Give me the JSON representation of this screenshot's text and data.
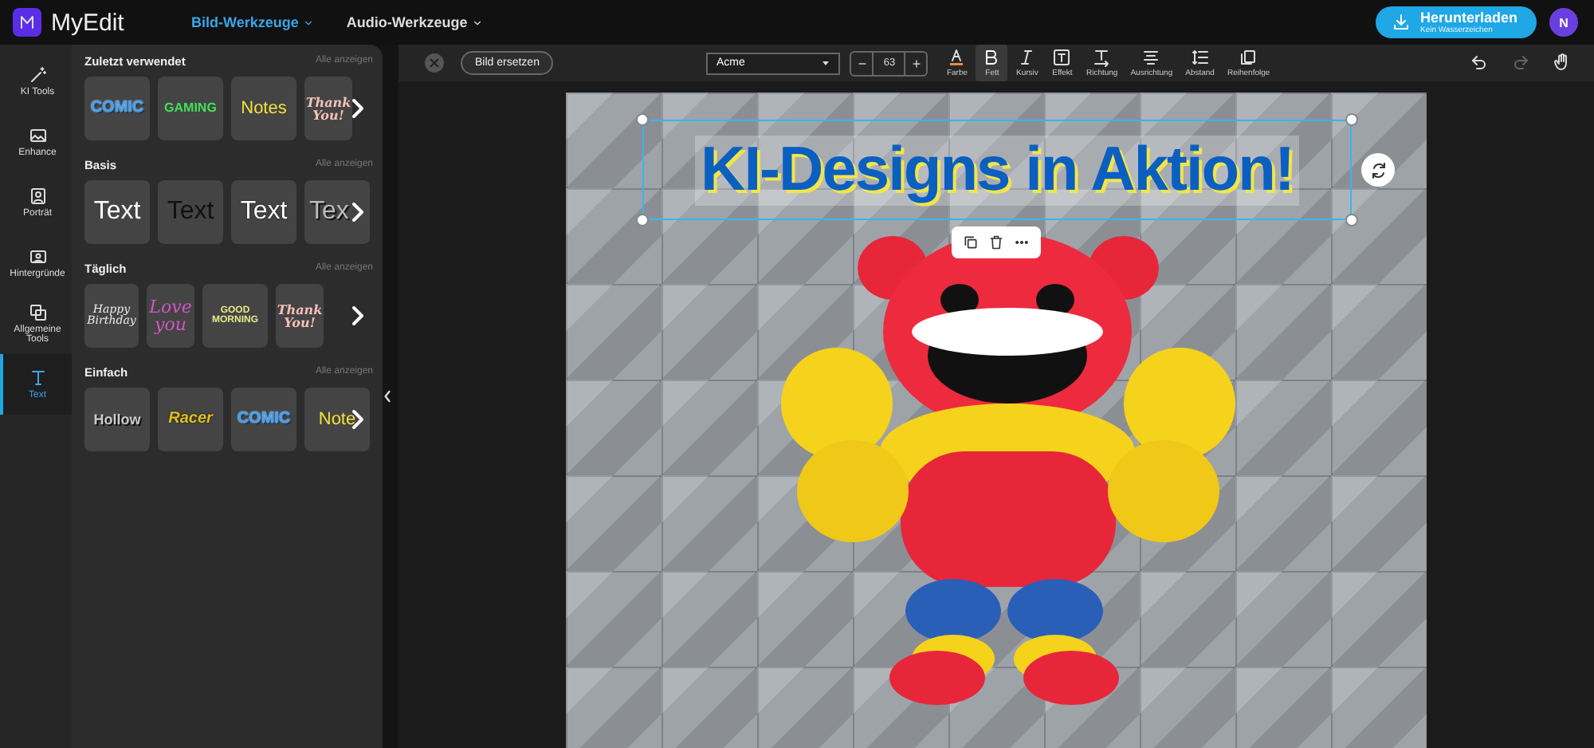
{
  "app": {
    "name": "MyEdit"
  },
  "top_menu": [
    {
      "label": "Bild-Werkzeuge",
      "selected": true
    },
    {
      "label": "Audio-Werkzeuge",
      "selected": false
    }
  ],
  "download": {
    "label": "Herunterladen",
    "sublabel": "Kein Wasserzeichen"
  },
  "avatar": {
    "initial": "N"
  },
  "nav": [
    {
      "label": "KI Tools",
      "kind": "wand",
      "selected": false
    },
    {
      "label": "Enhance",
      "kind": "enhance",
      "selected": false
    },
    {
      "label": "Porträt",
      "kind": "portrait",
      "selected": false
    },
    {
      "label": "Hintergründe",
      "kind": "background",
      "selected": false
    },
    {
      "label": "Allgemeine Tools",
      "kind": "tools",
      "selected": false
    },
    {
      "label": "Text",
      "kind": "text",
      "selected": true
    }
  ],
  "sections": [
    {
      "title": "Zuletzt verwendet",
      "link": "Alle anzeigen",
      "presets": [
        {
          "text": "COMIC",
          "kind": "comic"
        },
        {
          "text": "GAMING",
          "kind": "gaming"
        },
        {
          "text": "Notes",
          "kind": "notes"
        },
        {
          "text": "Thank You!",
          "kind": "thanks"
        }
      ]
    },
    {
      "title": "Basis",
      "link": "Alle anzeigen",
      "presets": [
        {
          "text": "Text",
          "kind": "white"
        },
        {
          "text": "Text",
          "kind": "black"
        },
        {
          "text": "Text",
          "kind": "outline"
        },
        {
          "text": "Tex",
          "kind": "shadow"
        }
      ]
    },
    {
      "title": "Täglich",
      "link": "Alle anzeigen",
      "presets": [
        {
          "text": "Happy Birthday",
          "kind": "birthday"
        },
        {
          "text": "Love you",
          "kind": "love"
        },
        {
          "text": "GOOD MORNING",
          "kind": "morning"
        },
        {
          "text": "Thank You!",
          "kind": "thanks"
        }
      ]
    },
    {
      "title": "Einfach",
      "link": "Alle anzeigen",
      "presets": [
        {
          "text": "Hollow",
          "kind": "hollow"
        },
        {
          "text": "Racer",
          "kind": "racer"
        },
        {
          "text": "COMIC",
          "kind": "comic"
        },
        {
          "text": "Note",
          "kind": "notes"
        }
      ]
    }
  ],
  "toolbar": {
    "replace_button": "Bild ersetzen",
    "font": "Acme",
    "decrease": "−",
    "font_size": "63",
    "increase": "+",
    "tools": [
      {
        "label": "Farbe",
        "kind": "color",
        "selected": false
      },
      {
        "label": "Fett",
        "kind": "bold",
        "selected": true
      },
      {
        "label": "Kursiv",
        "kind": "italic",
        "selected": false
      },
      {
        "label": "Effekt",
        "kind": "effect",
        "selected": false
      },
      {
        "label": "Richtung",
        "kind": "direction",
        "selected": false
      },
      {
        "label": "Ausrichtung",
        "kind": "align",
        "selected": false
      },
      {
        "label": "Abstand",
        "kind": "spacing",
        "selected": false
      },
      {
        "label": "Reihenfolge",
        "kind": "order",
        "selected": false
      }
    ],
    "undo_disabled": false,
    "redo_disabled": true
  },
  "canvas": {
    "text_layer": "KI-Designs in Aktion!"
  }
}
